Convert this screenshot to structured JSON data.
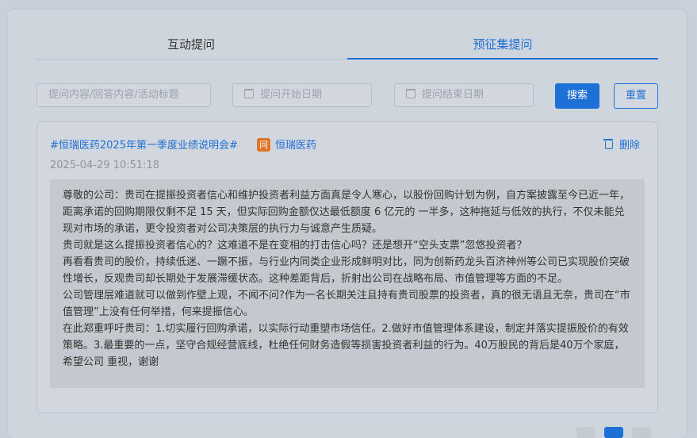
{
  "tabs": [
    {
      "label": "互动提问",
      "active": false
    },
    {
      "label": "预征集提问",
      "active": true
    }
  ],
  "filters": {
    "keyword_placeholder": "提问内容/回答内容/活动标题",
    "start_date_placeholder": "提问开始日期",
    "end_date_placeholder": "提问结束日期",
    "search_label": "搜索",
    "reset_label": "重置"
  },
  "question": {
    "topic": "#恒瑞医药2025年第一季度业绩说明会#",
    "company_badge": "问",
    "company_name": "恒瑞医药",
    "delete_label": "删除",
    "timestamp": "2025-04-29 10:51:18",
    "paragraphs": [
      "尊敬的公司：贵司在提振投资者信心和维护投资者利益方面真是令人寒心，以股份回购计划为例，自方案披露至今已近一年，距离承诺的回购期限仅剩不足 15 天，但实际回购金额仅达最低额度 6 亿元的 一半多，这种拖延与低效的执行，不仅未能兑现对市场的承诺，更令投资者对公司决策层的执行力与诚意产生质疑。",
      "贵司就是这么提振投资者信心的？这难道不是在变相的打击信心吗？还是想开“空头支票”忽悠投资者？",
      "再看看贵司的股价，持续低迷、一蹶不振，与行业内同类企业形成鲜明对比，同为创新药龙头百济神州等公司已实现股价突破性增长，反观贵司却长期处于发展滞缓状态。这种差距背后，折射出公司在战略布局、市值管理等方面的不足。",
      "公司管理层难道就可以做到作壁上观，不闻不问?作为一名长期关注且持有贵司股票的投资者，真的很无语且无奈，贵司在“市值管理”上没有任何举措，何来提振信心。",
      "在此郑重呼吁贵司：1.切实履行回购承诺，以实际行动重塑市场信任。2.做好市值管理体系建设，制定并落实提振股价的有效策略。3.最重要的一点，坚守合规经营底线，杜绝任何财务造假等损害投资者利益的行为。40万股民的背后是40万个家庭，希望公司 重视，谢谢"
    ]
  },
  "colors": {
    "accent": "#1e6fd6",
    "company_badge": "#e0752a"
  }
}
